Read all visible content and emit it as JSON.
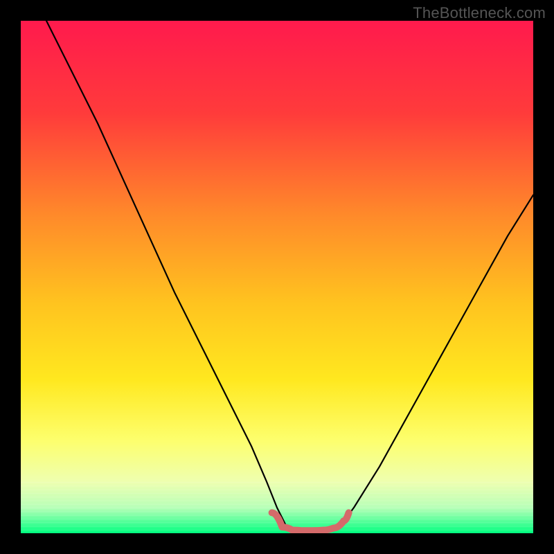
{
  "watermark": "TheBottleneck.com",
  "chart_data": {
    "type": "line",
    "title": "",
    "xlabel": "",
    "ylabel": "",
    "xlim": [
      0,
      100
    ],
    "ylim": [
      0,
      100
    ],
    "gradient_stops": [
      {
        "offset": 0,
        "color": "#ff1a4d"
      },
      {
        "offset": 18,
        "color": "#ff3b3b"
      },
      {
        "offset": 38,
        "color": "#ff8a2a"
      },
      {
        "offset": 55,
        "color": "#ffc31f"
      },
      {
        "offset": 70,
        "color": "#ffe81f"
      },
      {
        "offset": 82,
        "color": "#fdff6e"
      },
      {
        "offset": 90,
        "color": "#eeffb0"
      },
      {
        "offset": 95,
        "color": "#b8ffb8"
      },
      {
        "offset": 100,
        "color": "#00ff7f"
      }
    ],
    "series": [
      {
        "name": "bottleneck-curve-left",
        "stroke": "#000000",
        "x": [
          5,
          10,
          15,
          20,
          25,
          30,
          35,
          40,
          45,
          48,
          50,
          52
        ],
        "y": [
          100,
          90,
          80,
          69,
          58,
          47,
          37,
          27,
          17,
          10,
          5,
          1
        ]
      },
      {
        "name": "bottleneck-curve-right",
        "stroke": "#000000",
        "x": [
          62,
          65,
          70,
          75,
          80,
          85,
          90,
          95,
          100
        ],
        "y": [
          1,
          5,
          13,
          22,
          31,
          40,
          49,
          58,
          66
        ]
      },
      {
        "name": "flat-bottom-highlight",
        "stroke": "#d46a6a",
        "x": [
          49,
          51,
          53,
          55,
          57,
          59,
          61,
          63,
          64
        ],
        "y": [
          4,
          1.2,
          0.6,
          0.5,
          0.5,
          0.6,
          1.0,
          2.4,
          4
        ]
      }
    ]
  }
}
